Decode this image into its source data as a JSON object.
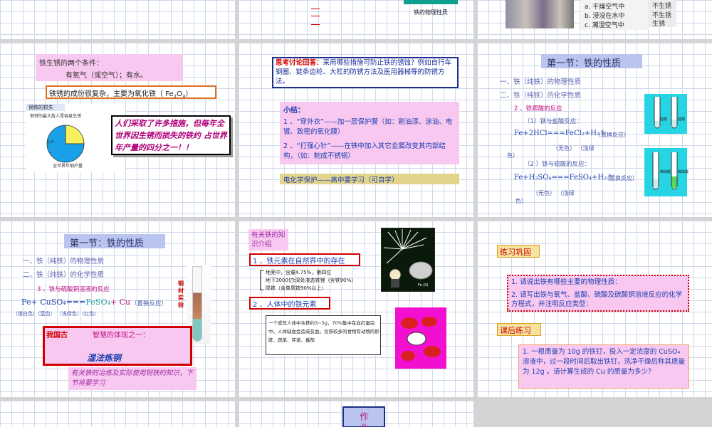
{
  "s1": {},
  "s2": {
    "caption": "铁的物理性质"
  },
  "s3": {
    "options": [
      "a. 干燥空气中",
      "b. 浸没在水中",
      "c. 潮湿空气中"
    ],
    "results": [
      "不生锈",
      "不生锈",
      "生锈"
    ]
  },
  "s4": {
    "conditions_title": "铁生锈的两个条件：",
    "conditions_body": "有氧气（或空气）；有水。",
    "rust_main": "铁锈的成份很复杂，主要为氧化铁（ Fe",
    "rust_sub1": "2",
    "rust_o": "O",
    "rust_sub2": "3",
    "rust_close": "）",
    "pie_header": "钢铁的损失",
    "pie_subheader": "钢铁的最大敌人是容易生锈",
    "pie_slice_label": "1/4",
    "pie_caption": "全世界年钢产量",
    "statement": "人们采取了许多措施，但每年全世界因生锈而损失的铁约 占世界年产量的四分之一！！",
    "chart_data": {
      "type": "pie",
      "values": [
        0.25,
        0.75
      ]
    }
  },
  "s5": {
    "discuss_label": "思考讨论回答：",
    "discuss_text": "采用哪些措施可防止铁的锈蚀？例如自行车钢圈、链条齿轮、大杠的防锈方法及医用器械等的防锈方法。",
    "summary_title": "小结：",
    "summary_1": "1 、“穿外衣”——加一层保护膜（如：刷油漆、涂油、电镀、致密的氧化膜）",
    "summary_2": "2 、“打强心针”——在铁中加入其它金属改变其内部结构，（如：制成不锈钢）",
    "electro": "电化学保护——高中要学习（可自学）"
  },
  "s6": {
    "section_title": "第一节：铁的性质",
    "item1": "一、铁（纯铁）的物理性质",
    "item2": "二、铁（纯铁）的化学性质",
    "sub2": "2 、铁跟酸的反应",
    "sub2_1": "（1）铁与盐酸反应：",
    "eq1": "Fe+2HCl===FeCl₂+H₂↑",
    "eq1_note": "（置换反应）",
    "eq1_colors": "（无色）  （浅绿",
    "eq1_colors2": "色）",
    "sub2_2": "（2 ）铁与硫酸的反应：",
    "eq2": "Fe+H₂SO₄===FeSO₄+H₂↑",
    "eq2_note": "（置换反应）",
    "eq2_colors": "（无色）  （浅绿",
    "eq2_colors2": "色）",
    "tube_labels": [
      "盐酸",
      "盐酸",
      "稀硫酸",
      "稀硫酸"
    ]
  },
  "s7": {
    "section_title": "第一节：铁的性质",
    "item1": "一、铁（纯铁）的物理性质",
    "item2": "二、铁（纯铁）的化学性质",
    "sub3": "3 、铁与硫酸铜溶液的反应",
    "eq_fe": "Fe+ CuSO₄===",
    "eq_feso4": "FeSO₄",
    "eq_cu": "+ Cu",
    "eq_note": "（置换反应）",
    "eq_colors": "（银白色）（蓝色）        （浅绿色）（红色）",
    "vert_label": "铜材实验",
    "wisdom_red": "我国古",
    "wisdom_text": "智慧的体现之一：",
    "wisdom_blue": "湿法炼铜",
    "footer": "有关铁的冶炼及实际使用铜铁的知识，下节将要学习"
  },
  "s8": {
    "intro": "有关铁的知识介绍",
    "h1": "1 、铁元素在自然界中的存在",
    "b1": "地壳中，含量4.75%，第四位",
    "b2": "地下3000亿t深处液态铁锂（含铁90%）",
    "b3": "陨铁（含单质铁90%以上）",
    "h2": "2 、人体中的铁元素",
    "body_text": "一个成年人体中含铁约3~5g，70%集中在血红蛋白中。人体缺血会造成贫血。含铁较多的食物有动物的肝脏、蔬菜、芹菜、番茄",
    "fe_label": "Fe (0)"
  },
  "s9": {
    "practice_title": "练习巩固",
    "q1": "1.  请说出铁有哪些主要的物理性质：",
    "q2": "2.   请写出铁与氧气、盐酸、硫酸及硫酸铜溶液反应的化学方程式，并注明反应类型：",
    "homework_title": "课后练习",
    "hw1": "1.  一根质量为 10g 的铁钉，投入一定浓度的 CuSO₄ 溶液中，过一段时间后取出铁钉，洗净干燥后称其质量为 12g 。请计算生成的 Cu 的质量为多少？"
  },
  "s11": {
    "zuo": "作",
    "ye": "业"
  },
  "colors": {
    "grid": "#cfd8ea",
    "pink": "#f9c8f0",
    "title_bg": "#b9c5ee",
    "red_border": "#d00000",
    "navy_border": "#1c2f8a"
  }
}
